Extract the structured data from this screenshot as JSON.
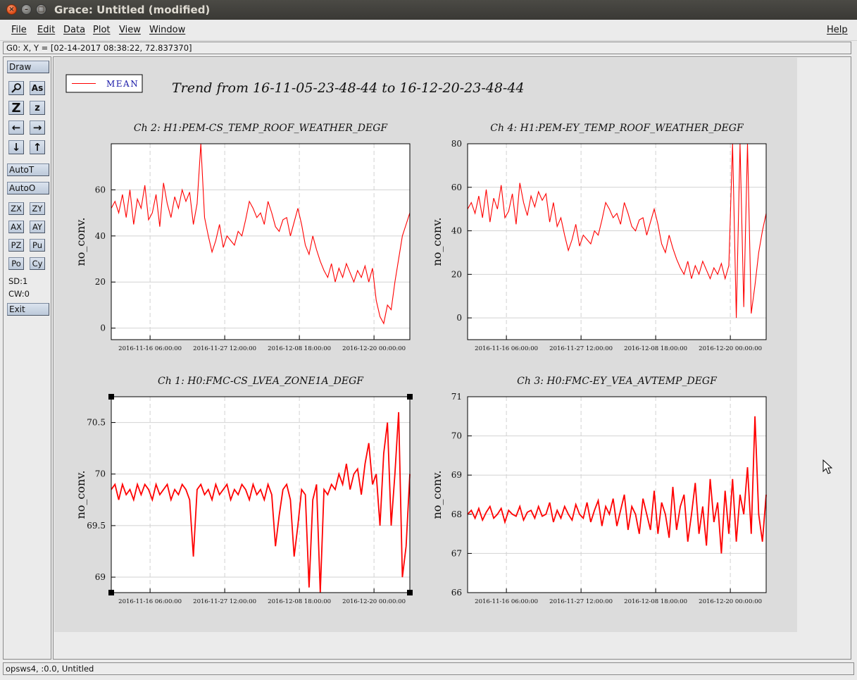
{
  "window": {
    "title": "Grace: Untitled (modified)",
    "close_glyph": "×",
    "min_glyph": "–",
    "max_glyph": "□"
  },
  "menu": {
    "file": "File",
    "edit": "Edit",
    "data": "Data",
    "plot": "Plot",
    "view": "View",
    "window": "Window",
    "help": "Help"
  },
  "locator": "G0: X, Y = [02-14-2017 08:38:22, 72.837370]",
  "toolbar": {
    "draw": "Draw",
    "autot": "AutoT",
    "autoo": "AutoO",
    "zx": "ZX",
    "zy": "ZY",
    "ax": "AX",
    "ay": "AY",
    "pz": "PZ",
    "pu": "Pu",
    "po": "Po",
    "cy": "Cy",
    "sd": "SD:1",
    "cw": "CW:0",
    "exit": "Exit",
    "zoom_glyph": "Z",
    "zoom_small_glyph": "z",
    "text_glyph": "As",
    "left_glyph": "←",
    "right_glyph": "→",
    "down_glyph": "↓",
    "up_glyph": "↑"
  },
  "status": "opsws4, :0.0, Untitled",
  "colors": {
    "series": "#ff0000",
    "legend_text": "#1a1aa8",
    "grid": "#d2d2d2",
    "page": "#dcdcdc"
  },
  "chart_data": [
    {
      "type": "line",
      "title": "Ch 2: H1:PEM-CS_TEMP_ROOF_WEATHER_DEGF",
      "ylabel": "no_conv.",
      "x_ticks": [
        "2016-11-16 06:00:00",
        "2016-11-27 12:00:00",
        "2016-12-08 18:00:00",
        "2016-12-20 00:00:00"
      ],
      "x_range": [
        "2016-11-05 23:48:44",
        "2016-12-20 23:48:44"
      ],
      "ylim": [
        -5,
        80
      ],
      "y_ticks": [
        0,
        20,
        40,
        60
      ],
      "series": [
        {
          "name": "MEAN",
          "values": [
            52,
            55,
            50,
            58,
            48,
            60,
            45,
            56,
            52,
            62,
            47,
            50,
            58,
            44,
            63,
            54,
            48,
            57,
            52,
            60,
            55,
            59,
            45,
            54,
            80,
            48,
            40,
            33,
            38,
            45,
            35,
            40,
            38,
            36,
            42,
            40,
            47,
            55,
            52,
            48,
            50,
            45,
            55,
            50,
            44,
            42,
            47,
            48,
            40,
            46,
            52,
            45,
            36,
            32,
            40,
            34,
            29,
            25,
            22,
            28,
            20,
            26,
            22,
            28,
            24,
            20,
            25,
            22,
            27,
            20,
            26,
            12,
            5,
            2,
            10,
            8,
            20,
            30,
            40,
            45,
            50
          ]
        }
      ]
    },
    {
      "type": "line",
      "title": "Ch 4: H1:PEM-EY_TEMP_ROOF_WEATHER_DEGF",
      "ylabel": "no_conv.",
      "x_ticks": [
        "2016-11-16 06:00:00",
        "2016-11-27 12:00:00",
        "2016-12-08 18:00:00",
        "2016-12-20 00:00:00"
      ],
      "x_range": [
        "2016-11-05 23:48:44",
        "2016-12-20 23:48:44"
      ],
      "ylim": [
        -10,
        80
      ],
      "y_ticks": [
        0,
        20,
        40,
        60,
        80
      ],
      "series": [
        {
          "name": "MEAN",
          "values": [
            50,
            53,
            48,
            56,
            46,
            59,
            44,
            55,
            50,
            61,
            46,
            49,
            57,
            43,
            62,
            53,
            47,
            56,
            51,
            58,
            54,
            57,
            44,
            53,
            42,
            46,
            38,
            31,
            36,
            43,
            33,
            38,
            36,
            34,
            40,
            38,
            45,
            53,
            50,
            46,
            48,
            43,
            53,
            48,
            42,
            40,
            45,
            46,
            38,
            44,
            50,
            43,
            34,
            30,
            38,
            32,
            27,
            23,
            20,
            26,
            18,
            24,
            20,
            26,
            22,
            18,
            23,
            20,
            25,
            18,
            24,
            80,
            0,
            80,
            5,
            80,
            2,
            15,
            30,
            40,
            48
          ]
        }
      ]
    },
    {
      "type": "line",
      "title": "Ch 1: H0:FMC-CS_LVEA_ZONE1A_DEGF",
      "ylabel": "no_conv.",
      "x_ticks": [
        "2016-11-16 06:00:00",
        "2016-11-27 12:00:00",
        "2016-12-08 18:00:00",
        "2016-12-20 00:00:00"
      ],
      "x_range": [
        "2016-11-05 23:48:44",
        "2016-12-20 23:48:44"
      ],
      "ylim": [
        68.85,
        70.75
      ],
      "y_ticks": [
        69,
        69.5,
        70,
        70.5
      ],
      "series": [
        {
          "name": "MEAN",
          "values": [
            69.85,
            69.9,
            69.75,
            69.9,
            69.8,
            69.85,
            69.75,
            69.9,
            69.8,
            69.9,
            69.85,
            69.75,
            69.9,
            69.8,
            69.85,
            69.9,
            69.75,
            69.85,
            69.8,
            69.9,
            69.85,
            69.75,
            69.2,
            69.85,
            69.9,
            69.8,
            69.85,
            69.75,
            69.9,
            69.8,
            69.85,
            69.9,
            69.75,
            69.85,
            69.8,
            69.9,
            69.85,
            69.75,
            69.9,
            69.8,
            69.85,
            69.75,
            69.9,
            69.8,
            69.3,
            69.6,
            69.85,
            69.9,
            69.75,
            69.2,
            69.5,
            69.85,
            69.8,
            68.9,
            69.75,
            69.9,
            68.85,
            69.85,
            69.8,
            69.9,
            69.85,
            70.0,
            69.9,
            70.1,
            69.85,
            70.0,
            70.05,
            69.8,
            70.1,
            70.3,
            69.9,
            70.0,
            69.5,
            70.2,
            70.5,
            69.5,
            70.0,
            70.6,
            69.0,
            69.3,
            70.0
          ]
        }
      ]
    },
    {
      "type": "line",
      "title": "Ch 3: H0:FMC-EY_VEA_AVTEMP_DEGF",
      "ylabel": "no_conv.",
      "x_ticks": [
        "2016-11-16 06:00:00",
        "2016-11-27 12:00:00",
        "2016-12-08 18:00:00",
        "2016-12-20 00:00:00"
      ],
      "x_range": [
        "2016-11-05 23:48:44",
        "2016-12-20 23:48:44"
      ],
      "ylim": [
        66,
        71
      ],
      "y_ticks": [
        66,
        67,
        68,
        69,
        70,
        71
      ],
      "series": [
        {
          "name": "MEAN",
          "values": [
            68.0,
            68.1,
            67.9,
            68.15,
            67.85,
            68.05,
            68.2,
            67.9,
            68.0,
            68.15,
            67.8,
            68.1,
            68.0,
            67.95,
            68.2,
            67.85,
            68.05,
            68.1,
            67.9,
            68.2,
            67.95,
            68.0,
            68.3,
            67.8,
            68.1,
            67.9,
            68.2,
            68.0,
            67.85,
            68.25,
            68.0,
            67.9,
            68.3,
            67.8,
            68.1,
            68.35,
            67.7,
            68.2,
            68.0,
            68.4,
            67.7,
            68.1,
            68.5,
            67.6,
            68.2,
            68.0,
            67.5,
            68.4,
            68.0,
            67.6,
            68.6,
            67.5,
            68.3,
            68.0,
            67.4,
            68.7,
            67.6,
            68.2,
            68.5,
            67.3,
            68.0,
            68.8,
            67.5,
            68.2,
            67.2,
            68.9,
            67.8,
            68.3,
            67.0,
            68.6,
            67.5,
            68.9,
            67.3,
            68.5,
            68.0,
            69.2,
            67.5,
            70.5,
            68.0,
            67.3,
            68.5
          ]
        }
      ]
    }
  ],
  "legend": {
    "label": "MEAN"
  },
  "graph_title": "Trend from 16-11-05-23-48-44 to 16-12-20-23-48-44"
}
